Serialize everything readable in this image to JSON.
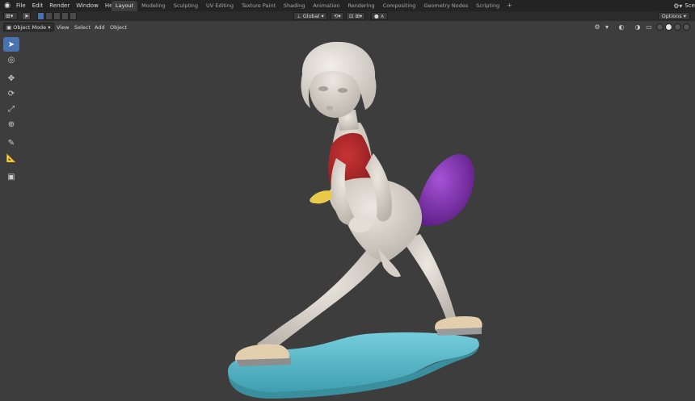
{
  "menubar": {
    "items": [
      "File",
      "Edit",
      "Render",
      "Window",
      "Help"
    ]
  },
  "workspaces": {
    "tabs": [
      "Layout",
      "Modeling",
      "Sculpting",
      "UV Editing",
      "Texture Paint",
      "Shading",
      "Animation",
      "Rendering",
      "Compositing",
      "Geometry Nodes",
      "Scripting"
    ],
    "active": "Layout",
    "add_label": "+"
  },
  "top_right": {
    "scene_label": "Sce"
  },
  "header": {
    "transform_orientation": "Global",
    "options_label": "Options"
  },
  "viewport_header": {
    "mode": "Object Mode",
    "menus": [
      "View",
      "Select",
      "Add",
      "Object"
    ]
  },
  "toolbar": {
    "tools": [
      "select-box-icon",
      "cursor-icon",
      "move-icon",
      "rotate-icon",
      "scale-icon",
      "transform-icon",
      "annotate-icon",
      "measure-icon",
      "add-cube-icon"
    ],
    "active": "select-box-icon"
  },
  "colors": {
    "background": "#3d3d3d",
    "accent": "#4a72b0",
    "skin": "#dcd6ce",
    "top": "#b3272a",
    "tail": "#8a35b8",
    "beak": "#e8c94a",
    "puddle": "#5bbccb",
    "shoe": "#e3cfae"
  }
}
